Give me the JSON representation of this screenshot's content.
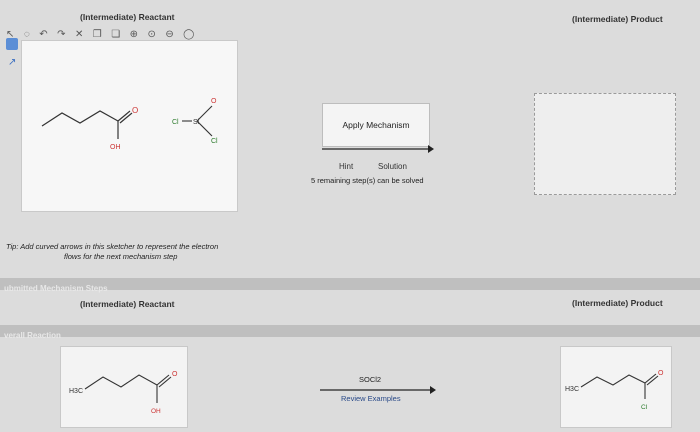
{
  "top": {
    "reactant_title": "(Intermediate) Reactant",
    "product_title": "(Intermediate) Product",
    "tip": "Tip: Add curved arrows in this sketcher to represent the electron flows for the next mechanism step",
    "tip_line1": "Tip: Add curved arrows in this sketcher to represent the electron",
    "tip_line2": "flows for the next mechanism step",
    "apply_label": "Apply Mechanism",
    "hint_label": "Hint",
    "solution_label": "Solution",
    "remaining_steps": "5 remaining step(s) can be solved"
  },
  "toolbar": {
    "icons": [
      "cursor-icon",
      "lasso-icon",
      "undo-icon",
      "redo-icon",
      "delete-icon",
      "copy-icon",
      "paste-icon",
      "zoom-in-icon",
      "zoom-fit-icon",
      "zoom-out-icon",
      "zoom-reset-icon"
    ]
  },
  "bars": {
    "submitted_label": "ubmitted Mechanism Steps",
    "overall_label": "verall Reaction"
  },
  "middle": {
    "reactant_title": "(Intermediate) Reactant",
    "product_title": "(Intermediate) Product"
  },
  "overall": {
    "reagent": "SOCl2",
    "review_label": "Review Examples"
  },
  "molecule_labels": {
    "carbonyl_o": "O",
    "hydroxyl": "OH",
    "ch3": "H3C",
    "cl": "Cl",
    "si_o": "O",
    "si": "Si",
    "si_cl": "Cl"
  }
}
